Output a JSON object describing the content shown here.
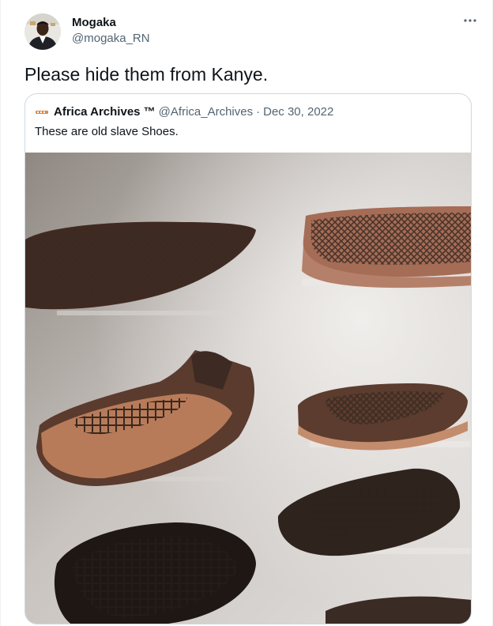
{
  "tweet": {
    "display_name": "Mogaka",
    "handle": "@mogaka_RN",
    "text": "Please hide them from Kanye.",
    "more_icon": "more-horizontal-icon"
  },
  "quote": {
    "display_name": "Africa Archives ™",
    "handle": "@Africa_Archives",
    "separator": "·",
    "date": "Dec 30, 2022",
    "text": "These are old slave Shoes."
  },
  "colors": {
    "text_primary": "#0f1419",
    "text_secondary": "#536471",
    "border": "#cfd9de"
  }
}
